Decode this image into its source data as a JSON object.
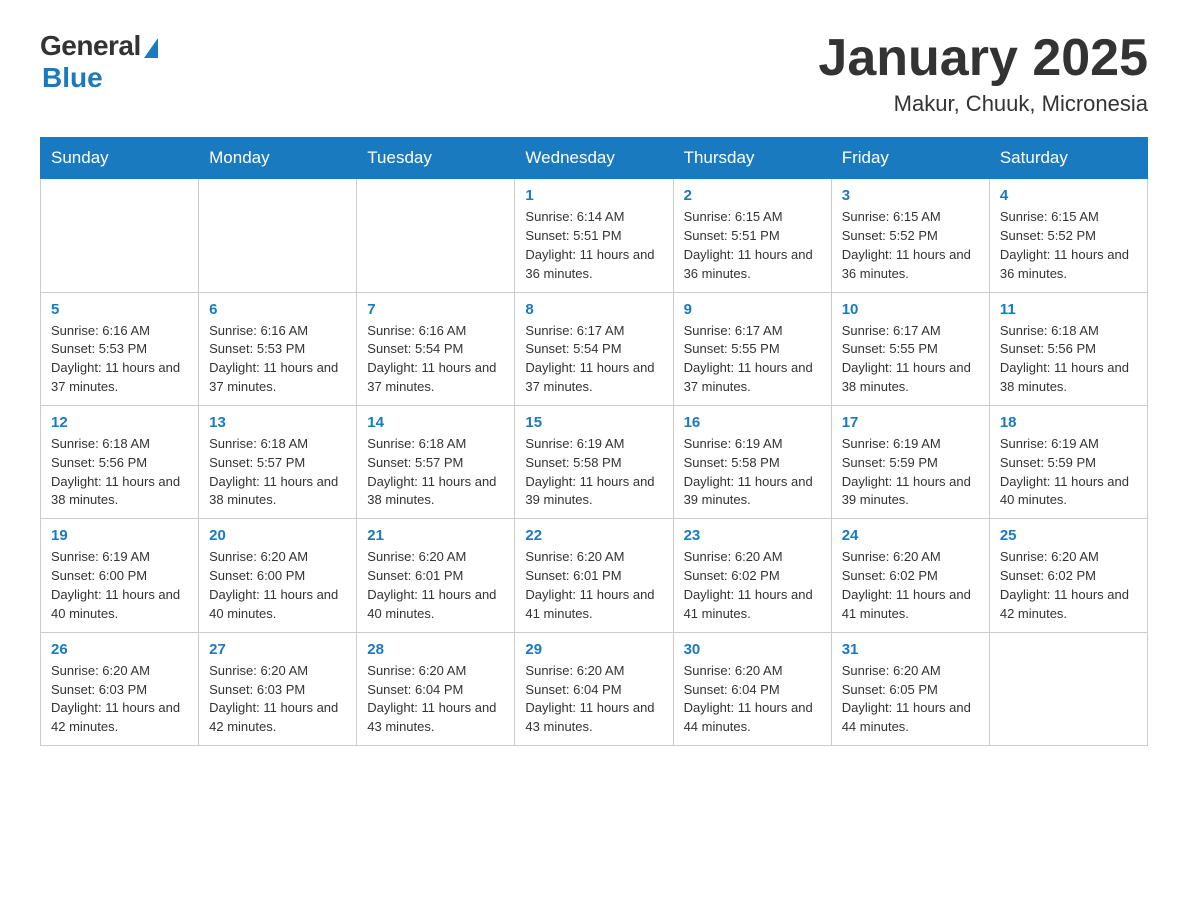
{
  "header": {
    "logo": {
      "general": "General",
      "blue": "Blue"
    },
    "title": "January 2025",
    "location": "Makur, Chuuk, Micronesia"
  },
  "days_of_week": [
    "Sunday",
    "Monday",
    "Tuesday",
    "Wednesday",
    "Thursday",
    "Friday",
    "Saturday"
  ],
  "weeks": [
    [
      {
        "day": "",
        "info": ""
      },
      {
        "day": "",
        "info": ""
      },
      {
        "day": "",
        "info": ""
      },
      {
        "day": "1",
        "info": "Sunrise: 6:14 AM\nSunset: 5:51 PM\nDaylight: 11 hours and 36 minutes."
      },
      {
        "day": "2",
        "info": "Sunrise: 6:15 AM\nSunset: 5:51 PM\nDaylight: 11 hours and 36 minutes."
      },
      {
        "day": "3",
        "info": "Sunrise: 6:15 AM\nSunset: 5:52 PM\nDaylight: 11 hours and 36 minutes."
      },
      {
        "day": "4",
        "info": "Sunrise: 6:15 AM\nSunset: 5:52 PM\nDaylight: 11 hours and 36 minutes."
      }
    ],
    [
      {
        "day": "5",
        "info": "Sunrise: 6:16 AM\nSunset: 5:53 PM\nDaylight: 11 hours and 37 minutes."
      },
      {
        "day": "6",
        "info": "Sunrise: 6:16 AM\nSunset: 5:53 PM\nDaylight: 11 hours and 37 minutes."
      },
      {
        "day": "7",
        "info": "Sunrise: 6:16 AM\nSunset: 5:54 PM\nDaylight: 11 hours and 37 minutes."
      },
      {
        "day": "8",
        "info": "Sunrise: 6:17 AM\nSunset: 5:54 PM\nDaylight: 11 hours and 37 minutes."
      },
      {
        "day": "9",
        "info": "Sunrise: 6:17 AM\nSunset: 5:55 PM\nDaylight: 11 hours and 37 minutes."
      },
      {
        "day": "10",
        "info": "Sunrise: 6:17 AM\nSunset: 5:55 PM\nDaylight: 11 hours and 38 minutes."
      },
      {
        "day": "11",
        "info": "Sunrise: 6:18 AM\nSunset: 5:56 PM\nDaylight: 11 hours and 38 minutes."
      }
    ],
    [
      {
        "day": "12",
        "info": "Sunrise: 6:18 AM\nSunset: 5:56 PM\nDaylight: 11 hours and 38 minutes."
      },
      {
        "day": "13",
        "info": "Sunrise: 6:18 AM\nSunset: 5:57 PM\nDaylight: 11 hours and 38 minutes."
      },
      {
        "day": "14",
        "info": "Sunrise: 6:18 AM\nSunset: 5:57 PM\nDaylight: 11 hours and 38 minutes."
      },
      {
        "day": "15",
        "info": "Sunrise: 6:19 AM\nSunset: 5:58 PM\nDaylight: 11 hours and 39 minutes."
      },
      {
        "day": "16",
        "info": "Sunrise: 6:19 AM\nSunset: 5:58 PM\nDaylight: 11 hours and 39 minutes."
      },
      {
        "day": "17",
        "info": "Sunrise: 6:19 AM\nSunset: 5:59 PM\nDaylight: 11 hours and 39 minutes."
      },
      {
        "day": "18",
        "info": "Sunrise: 6:19 AM\nSunset: 5:59 PM\nDaylight: 11 hours and 40 minutes."
      }
    ],
    [
      {
        "day": "19",
        "info": "Sunrise: 6:19 AM\nSunset: 6:00 PM\nDaylight: 11 hours and 40 minutes."
      },
      {
        "day": "20",
        "info": "Sunrise: 6:20 AM\nSunset: 6:00 PM\nDaylight: 11 hours and 40 minutes."
      },
      {
        "day": "21",
        "info": "Sunrise: 6:20 AM\nSunset: 6:01 PM\nDaylight: 11 hours and 40 minutes."
      },
      {
        "day": "22",
        "info": "Sunrise: 6:20 AM\nSunset: 6:01 PM\nDaylight: 11 hours and 41 minutes."
      },
      {
        "day": "23",
        "info": "Sunrise: 6:20 AM\nSunset: 6:02 PM\nDaylight: 11 hours and 41 minutes."
      },
      {
        "day": "24",
        "info": "Sunrise: 6:20 AM\nSunset: 6:02 PM\nDaylight: 11 hours and 41 minutes."
      },
      {
        "day": "25",
        "info": "Sunrise: 6:20 AM\nSunset: 6:02 PM\nDaylight: 11 hours and 42 minutes."
      }
    ],
    [
      {
        "day": "26",
        "info": "Sunrise: 6:20 AM\nSunset: 6:03 PM\nDaylight: 11 hours and 42 minutes."
      },
      {
        "day": "27",
        "info": "Sunrise: 6:20 AM\nSunset: 6:03 PM\nDaylight: 11 hours and 42 minutes."
      },
      {
        "day": "28",
        "info": "Sunrise: 6:20 AM\nSunset: 6:04 PM\nDaylight: 11 hours and 43 minutes."
      },
      {
        "day": "29",
        "info": "Sunrise: 6:20 AM\nSunset: 6:04 PM\nDaylight: 11 hours and 43 minutes."
      },
      {
        "day": "30",
        "info": "Sunrise: 6:20 AM\nSunset: 6:04 PM\nDaylight: 11 hours and 44 minutes."
      },
      {
        "day": "31",
        "info": "Sunrise: 6:20 AM\nSunset: 6:05 PM\nDaylight: 11 hours and 44 minutes."
      },
      {
        "day": "",
        "info": ""
      }
    ]
  ]
}
